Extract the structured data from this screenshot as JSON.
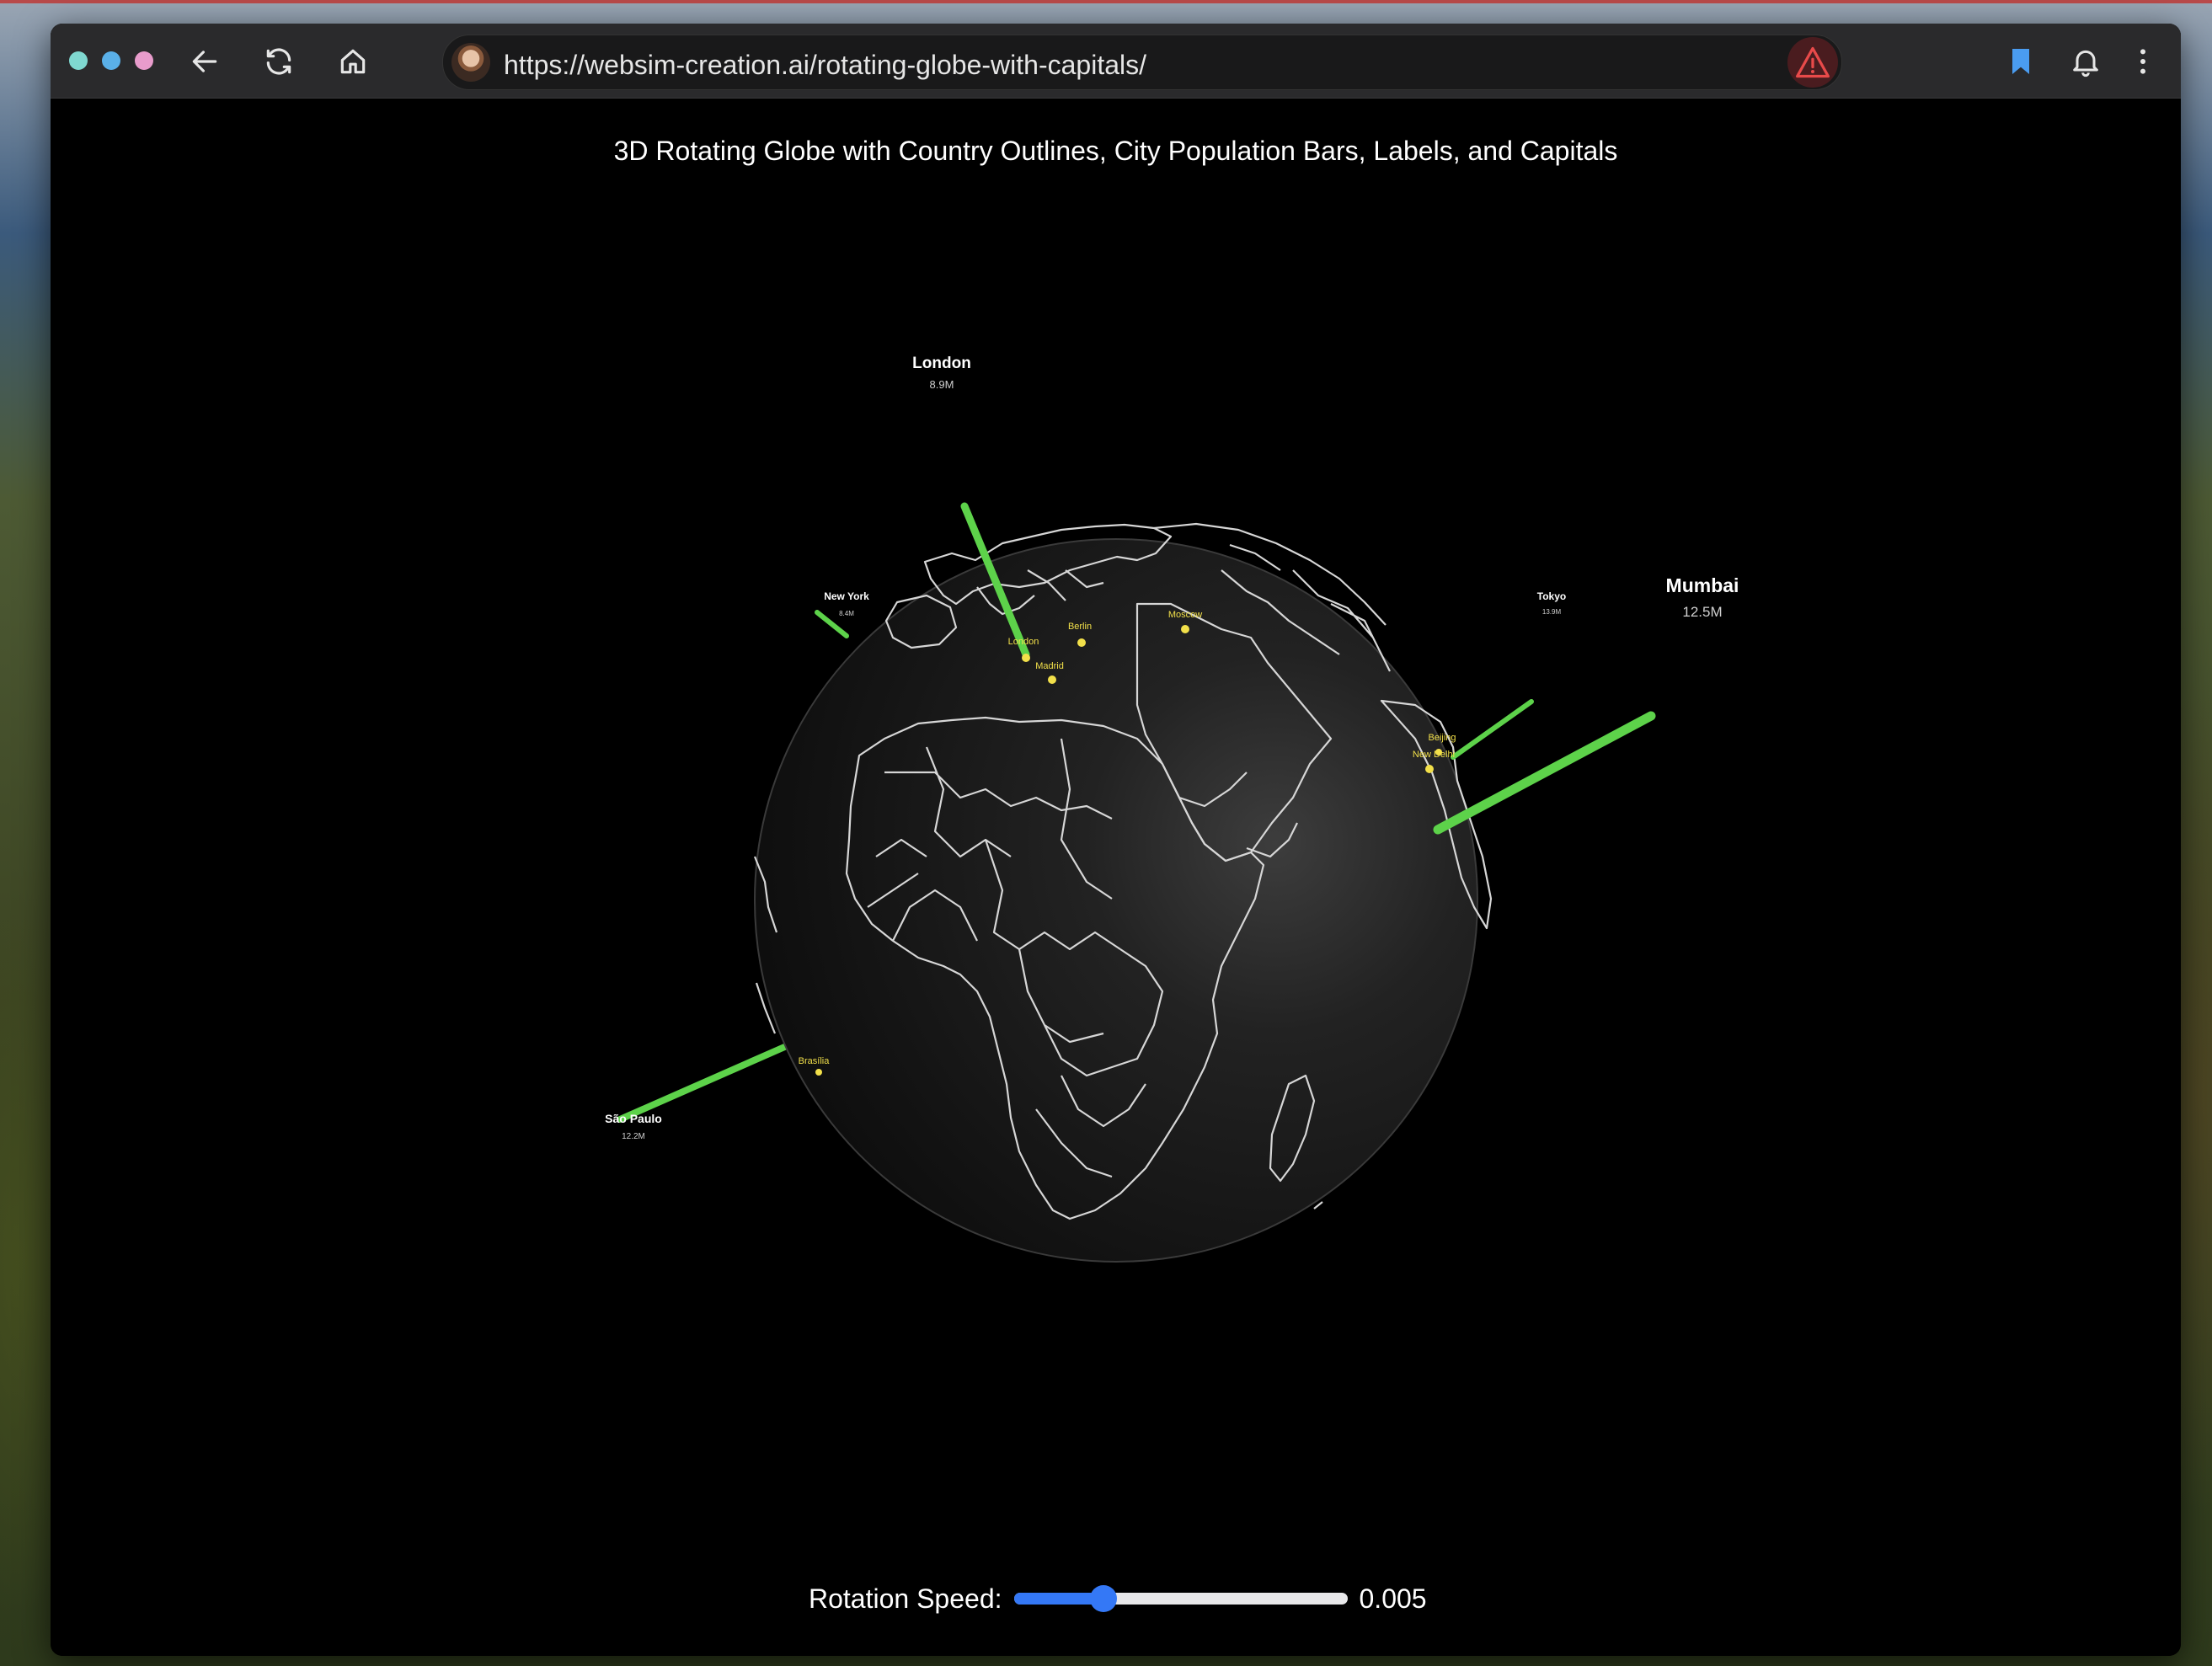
{
  "browser": {
    "url": "https://websim-creation.ai/rotating-globe-with-capitals/",
    "window_dot_colors": [
      "#7fd8d0",
      "#5ab0e8",
      "#e89ccc"
    ],
    "bookmark_color": "#4a9cf0",
    "warning_color": "#e84a4a",
    "icons": [
      "back-arrow-icon",
      "reload-icon",
      "home-icon",
      "avatar",
      "warning-icon",
      "bookmark-icon",
      "bell-icon",
      "more-vertical-icon"
    ]
  },
  "page": {
    "title": "3D Rotating Globe with Country Outlines, City Population Bars, Labels, and Capitals"
  },
  "cities": [
    {
      "name": "London",
      "population": "8.9M"
    },
    {
      "name": "New York",
      "population": "8.4M"
    },
    {
      "name": "Tokyo",
      "population": "13.9M"
    },
    {
      "name": "Mumbai",
      "population": "12.5M"
    },
    {
      "name": "São Paulo",
      "population": "12.2M"
    }
  ],
  "capitals": [
    {
      "name": "London"
    },
    {
      "name": "Berlin"
    },
    {
      "name": "Moscow"
    },
    {
      "name": "Madrid"
    },
    {
      "name": "New Delhi"
    },
    {
      "name": "Beijing"
    },
    {
      "name": "Brasília"
    }
  ],
  "colors": {
    "bar": "#5dd24a",
    "capital_dot": "#f2e04a",
    "globe": "#1c1c1c",
    "outline": "#d6d6d6"
  },
  "controls": {
    "rotation_label": "Rotation Speed:",
    "rotation_value": "0.005",
    "rotation_fraction": 0.27
  }
}
